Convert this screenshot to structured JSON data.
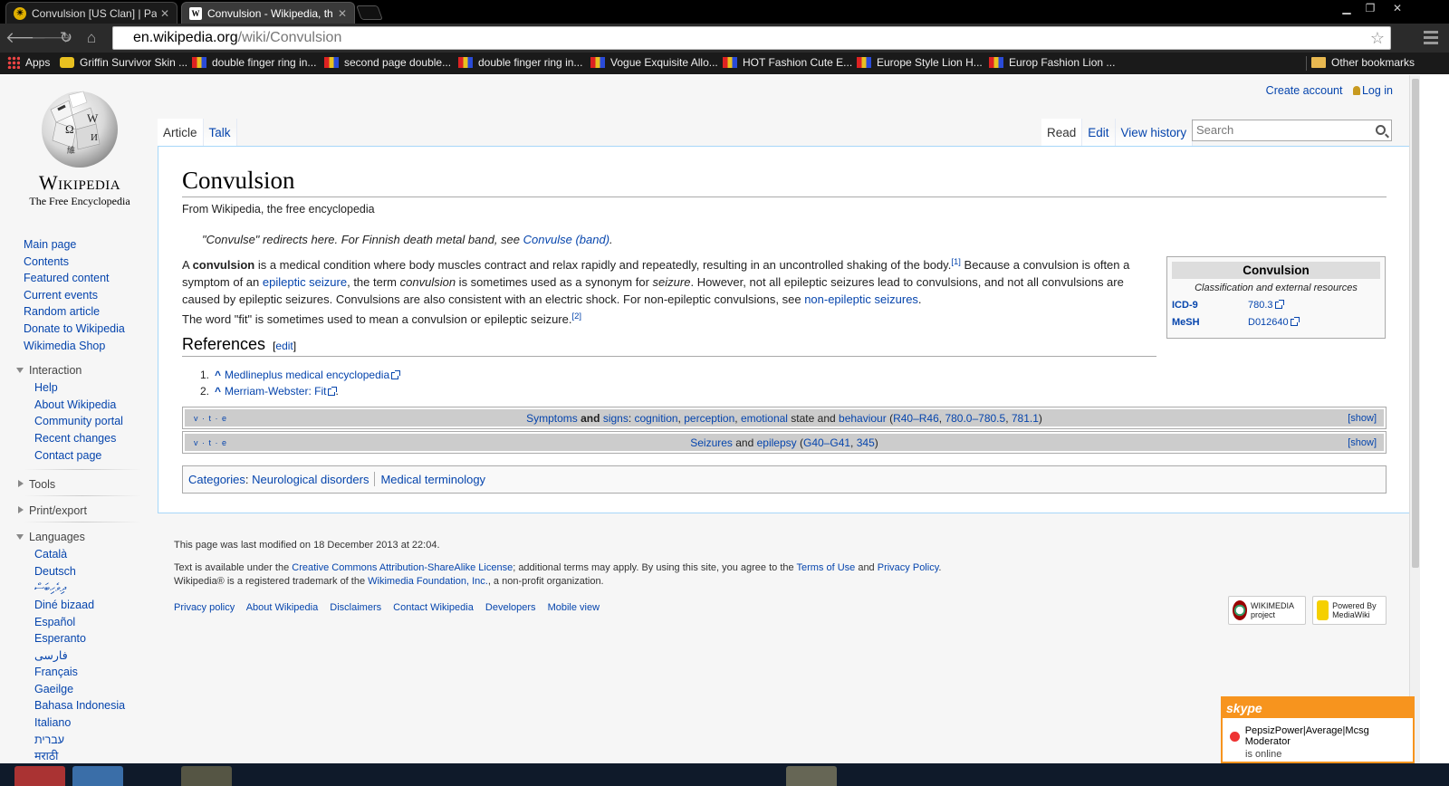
{
  "browser": {
    "tabs": [
      {
        "title": "Convulsion [US Clan] | Pa",
        "favicon": "griffin-icon"
      },
      {
        "title": "Convulsion - Wikipedia, th",
        "favicon": "W"
      }
    ],
    "url_host": "en.wikipedia.org",
    "url_path": "/wiki/Convulsion",
    "bookmarks": [
      "Apps",
      "Griffin Survivor Skin ...",
      "double finger ring in...",
      "second page double...",
      "double finger ring in...",
      "Vogue Exquisite Allo...",
      "HOT Fashion Cute E...",
      "Europe Style Lion H...",
      "Europ Fashion Lion ..."
    ],
    "other_bookmarks": "Other bookmarks"
  },
  "wiki": {
    "wordmark": "Wikipedia",
    "tagline": "The Free Encyclopedia",
    "personal": {
      "create_account": "Create account",
      "login": "Log in"
    },
    "nav": [
      "Main page",
      "Contents",
      "Featured content",
      "Current events",
      "Random article",
      "Donate to Wikipedia",
      "Wikimedia Shop"
    ],
    "interaction": {
      "label": "Interaction",
      "items": [
        "Help",
        "About Wikipedia",
        "Community portal",
        "Recent changes",
        "Contact page"
      ]
    },
    "tools_label": "Tools",
    "printexport_label": "Print/export",
    "languages": {
      "label": "Languages",
      "items": [
        "Català",
        "Deutsch",
        "ދިވެހިބަސް",
        "Diné bizaad",
        "Español",
        "Esperanto",
        "فارسی",
        "Français",
        "Gaeilge",
        "Bahasa Indonesia",
        "Italiano",
        "עברית",
        "मराठी"
      ]
    },
    "tabs_left": [
      "Article",
      "Talk"
    ],
    "tabs_right": [
      "Read",
      "Edit",
      "View history"
    ],
    "search_placeholder": "Search",
    "title": "Convulsion",
    "site_sub": "From Wikipedia, the free encyclopedia",
    "hatnote": {
      "text": "\"Convulse\" redirects here. For Finnish death metal band, see ",
      "link": "Convulse (band)",
      "end": "."
    },
    "p1": {
      "a": "A ",
      "bold": "convulsion",
      "b": " is a medical condition where body muscles contract and relax rapidly and repeatedly, resulting in an uncontrolled shaking of the body.",
      "sup1": "[1]",
      "c": " Because a convulsion is often a symptom of an ",
      "link1": "epileptic seizure",
      "d": ", the term ",
      "i1": "convulsion",
      "e": " is sometimes used as a synonym for ",
      "i2": "seizure",
      "f": ". However, not all epileptic seizures lead to convulsions, and not all convulsions are caused by epileptic seizures. Convulsions are also consistent with an electric shock. For non-epileptic convulsions, see ",
      "link2": "non-epileptic seizures",
      "g": "."
    },
    "p2": {
      "text": "The word \"fit\" is sometimes used to mean a convulsion or epileptic seizure.",
      "sup": "[2]"
    },
    "infobox": {
      "title": "Convulsion",
      "subtitle": "Classification and external resources",
      "rows": [
        {
          "key": "ICD-9",
          "value": "780.3"
        },
        {
          "key": "MeSH",
          "value": "D012640"
        }
      ]
    },
    "references": {
      "heading": "References",
      "edit": "[edit]",
      "items": [
        {
          "num": "1.",
          "text": "Medlineplus medical encyclopedia",
          "end": ""
        },
        {
          "num": "2.",
          "text": "Merriam-Webster: Fit",
          "end": "."
        }
      ]
    },
    "navbox1": {
      "vte": "v · t · e",
      "symptoms": "Symptoms",
      "and1": " and ",
      "signs": "signs",
      "colon": ": ",
      "cognition": "cognition",
      "c1": ", ",
      "perception": "perception",
      "c2": ", ",
      "emotional": "emotional",
      "state_and": " state and ",
      "behaviour": "behaviour",
      "open": " (",
      "r1": "R40–R46",
      "c3": ", ",
      "r2": "780.0–780.5",
      "c4": ", ",
      "r3": "781.1",
      "close": ")",
      "show": "[show]"
    },
    "navbox2": {
      "vte": "v · t · e",
      "seizures": "Seizures",
      "and": " and ",
      "epilepsy": "epilepsy",
      "open": " (",
      "r1": "G40–G41",
      "c": ", ",
      "r2": "345",
      "close": ")",
      "show": "[show]"
    },
    "categories": {
      "label": "Categories",
      "items": [
        "Neurological disorders",
        "Medical terminology"
      ]
    },
    "footer": {
      "last_modified": "This page was last modified on 18 December 2013 at 22:04.",
      "license_a": "Text is available under the ",
      "license_link": "Creative Commons Attribution-ShareAlike License",
      "license_b": "; additional terms may apply. By using this site, you agree to the ",
      "terms": "Terms of Use",
      "and": " and ",
      "privacy": "Privacy Policy",
      "period": ".",
      "trademark_a": "Wikipedia® is a registered trademark of the ",
      "foundation": "Wikimedia Foundation, Inc.",
      "trademark_b": ", a non-profit organization.",
      "places": [
        "Privacy policy",
        "About Wikipedia",
        "Disclaimers",
        "Contact Wikipedia",
        "Developers",
        "Mobile view"
      ],
      "badge1": "WIKIMEDIA project",
      "badge2": "Powered By MediaWiki"
    }
  },
  "skype": {
    "brand": "skype",
    "user": "PepsizPower|Average|Mcsg Moderator",
    "status": "is online"
  }
}
